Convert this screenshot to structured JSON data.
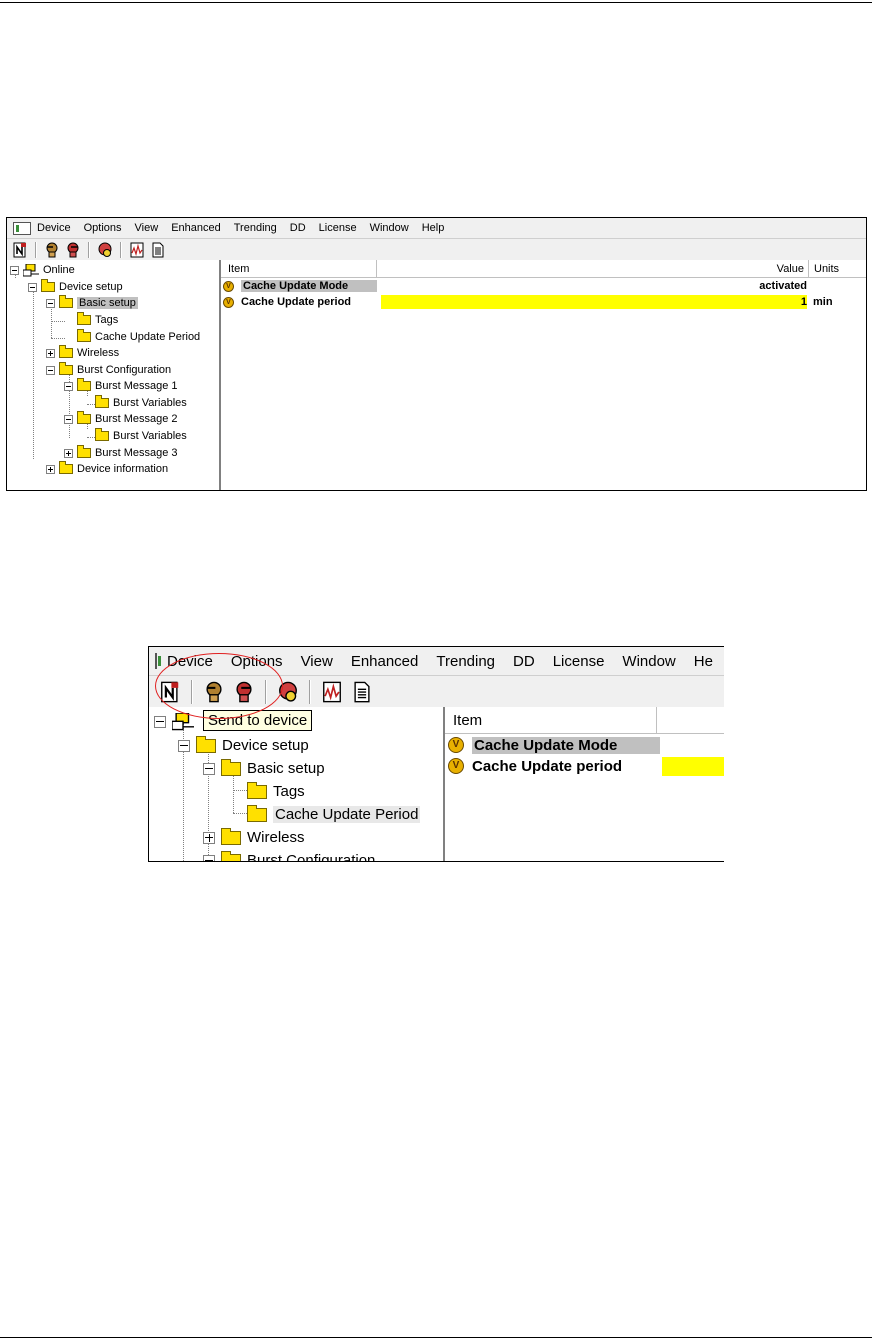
{
  "menu": [
    "Device",
    "Options",
    "View",
    "Enhanced",
    "Trending",
    "DD",
    "License",
    "Window",
    "Help"
  ],
  "menu_zoomed": [
    "Device",
    "Options",
    "View",
    "Enhanced",
    "Trending",
    "DD",
    "License",
    "Window",
    "He"
  ],
  "toolbar_icons": [
    "offline-device-icon",
    "receive-from-device-icon",
    "send-to-device-icon",
    "device-status-icon",
    "trend-icon",
    "document-icon"
  ],
  "tree": {
    "online": "Online",
    "device_setup": "Device setup",
    "basic_setup": "Basic setup",
    "tags": "Tags",
    "cache_update_period": "Cache Update Period",
    "wireless": "Wireless",
    "burst_configuration": "Burst Configuration",
    "burst_message_1": "Burst Message 1",
    "burst_variables_1": "Burst Variables",
    "burst_message_2": "Burst Message 2",
    "burst_variables_2": "Burst Variables",
    "burst_message_3": "Burst Message 3",
    "device_information": "Device information"
  },
  "list": {
    "columns": {
      "item": "Item",
      "value": "Value",
      "units": "Units"
    },
    "rows": [
      {
        "item": "Cache Update Mode",
        "value": "activated",
        "units": ""
      },
      {
        "item": "Cache Update period",
        "value": "1",
        "units": "min"
      }
    ]
  },
  "tooltip": "Send to device",
  "icon_glyph": "V",
  "colors": {
    "highlight_yellow": "#ffff00",
    "selection_gray": "#c0c0c0",
    "annotation_red": "#e02020",
    "folder_yellow": "#ffe000"
  }
}
